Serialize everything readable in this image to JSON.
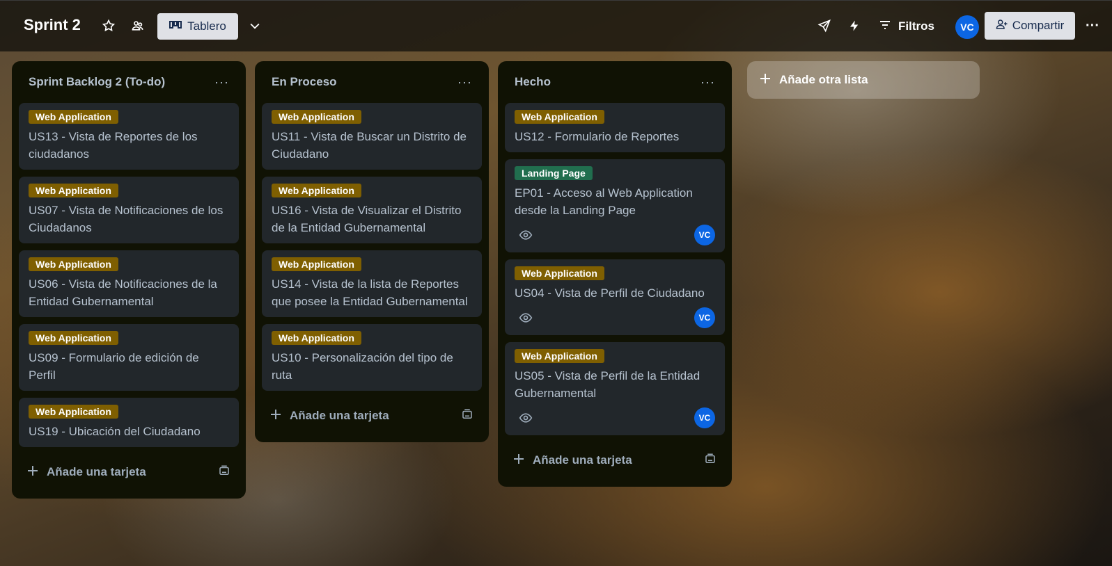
{
  "header": {
    "board_title": "Sprint 2",
    "view_label": "Tablero",
    "filters_label": "Filtros",
    "avatar_initials": "VC",
    "share_label": "Compartir",
    "more_label": "···",
    "icons": [
      "star-icon",
      "team-visibility-icon",
      "board-view-icon",
      "chevron-down-icon",
      "power-ups-icon",
      "automation-icon",
      "filter-icon",
      "add-person-icon",
      "more-icon"
    ]
  },
  "lists": [
    {
      "title": "Sprint Backlog 2 (To-do)",
      "menu": "···",
      "cards": [
        {
          "label": "Web Application",
          "title": "US13 - Vista de Reportes de los ciudadanos"
        },
        {
          "label": "Web Application",
          "title": "US07 - Vista de Notificaciones de los Ciudadanos"
        },
        {
          "label": "Web Application",
          "title": "US06 - Vista de Notificaciones de la Entidad Gubernamental"
        },
        {
          "label": "Web Application",
          "title": "US09 - Formulario de edición de Perfil"
        },
        {
          "label": "Web Application",
          "title": "US19 - Ubicación del Ciudadano"
        }
      ],
      "add_card": "Añade una tarjeta"
    },
    {
      "title": "En Proceso",
      "menu": "···",
      "cards": [
        {
          "label": "Web Application",
          "title": "US11 - Vista de Buscar un Distrito de Ciudadano"
        },
        {
          "label": "Web Application",
          "title": "US16 - Vista de Visualizar el Distrito de la Entidad Gubernamental"
        },
        {
          "label": "Web Application",
          "title": "US14 - Vista de la lista de Reportes que posee la Entidad Gubernamental"
        },
        {
          "label": "Web Application",
          "title": "US10 - Personalización del tipo de ruta"
        }
      ],
      "add_card": "Añade una tarjeta"
    },
    {
      "title": "Hecho",
      "menu": "···",
      "cards": [
        {
          "label": "Web Application",
          "title": "US12 - Formulario de Reportes"
        },
        {
          "label": "Landing Page",
          "title": "EP01 - Acceso al Web Application desde la Landing Page",
          "member": "VC"
        },
        {
          "label": "Web Application",
          "title": "US04 - Vista de Perfil de Ciudadano",
          "member": "VC"
        },
        {
          "label": "Web Application",
          "title": "US05 - Vista de Perfil de la Entidad Gubernamental",
          "member": "VC"
        }
      ],
      "add_card": "Añade una tarjeta"
    }
  ],
  "add_list_label": "Añade otra lista",
  "colors": {
    "label_web_application": "#7f5f01",
    "label_landing_page": "#216e4e",
    "list_bg": "#101204",
    "card_bg": "#22272b",
    "avatar": "#0c66e4"
  }
}
